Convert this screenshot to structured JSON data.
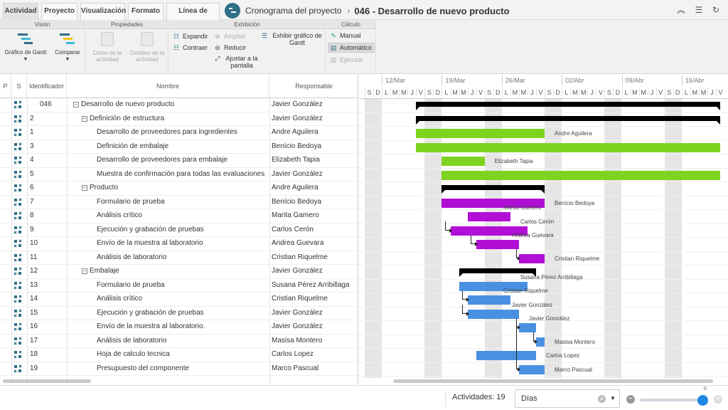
{
  "tabs": [
    {
      "label": "Actividad",
      "active": true
    },
    {
      "label": "Proyecto",
      "active": false
    },
    {
      "label": "Visualización",
      "active": false
    },
    {
      "label": "Formato",
      "active": false
    },
    {
      "label": "Línea de tiempo",
      "active": false
    }
  ],
  "breadcrumb": {
    "parent": "Cronograma del proyecto",
    "separator": "›",
    "title": "046 - Desarrollo de nuevo producto"
  },
  "top_icons": [
    "collapse-up-icon",
    "list-icon",
    "refresh-icon"
  ],
  "ribbon": {
    "vision": {
      "title": "Visión",
      "gantt_chart": "Gráfico de Gantt",
      "compare": "Comparar"
    },
    "properties": {
      "title": "Propiedades",
      "activity_data": "Datos de la actividad",
      "activity_details": "Detalles de la actividad"
    },
    "display": {
      "title": "Exhibición",
      "expand": "Expandir",
      "collapse": "Contraer",
      "zoom_in": "Ampliar",
      "zoom_out": "Reducir",
      "fit_screen": "Ajustar a la pantalla",
      "show_gantt": "Exhibir gráfico de Gantt"
    },
    "calc": {
      "title": "Cálculo",
      "manual": "Manual",
      "automatic": "Automático",
      "run": "Ejecutar"
    }
  },
  "grid": {
    "headers": {
      "p": "P",
      "s": "S",
      "id": "Identificador",
      "name": "Nombre",
      "responsible": "Responsable"
    },
    "rows": [
      {
        "id": "046",
        "name": "Desarrollo de nuevo producto",
        "resp": "Javier González",
        "level": 0,
        "toggle": "−"
      },
      {
        "id": "2",
        "name": "Definición de estructura",
        "resp": "Javier González",
        "level": 1,
        "toggle": "−"
      },
      {
        "id": "1",
        "name": "Desarrollo de proveedores para ingredientes",
        "resp": "Andre Aguilera",
        "level": 2,
        "toggle": ""
      },
      {
        "id": "3",
        "name": "Definición de embalaje",
        "resp": "Benício Bedoya",
        "level": 2,
        "toggle": ""
      },
      {
        "id": "4",
        "name": "Desarrollo de proveedores para embalaje",
        "resp": "Elizabeth Tapia",
        "level": 2,
        "toggle": ""
      },
      {
        "id": "5",
        "name": "Muestra de confirmación para todas las evaluaciones",
        "resp": "Javier González",
        "level": 2,
        "toggle": ""
      },
      {
        "id": "6",
        "name": "Producto",
        "resp": "Andre Aguilera",
        "level": 1,
        "toggle": "−"
      },
      {
        "id": "7",
        "name": "Formulario de prueba",
        "resp": "Benício Bedoya",
        "level": 2,
        "toggle": ""
      },
      {
        "id": "8",
        "name": "Análisis crítico",
        "resp": "Marita Gamero",
        "level": 2,
        "toggle": ""
      },
      {
        "id": "9",
        "name": "Ejecución y grabación de pruebas",
        "resp": "Carlos Cerón",
        "level": 2,
        "toggle": ""
      },
      {
        "id": "10",
        "name": "Envío de la muestra al laboratorio",
        "resp": "Andrea Guevara",
        "level": 2,
        "toggle": ""
      },
      {
        "id": "11",
        "name": "Análisis de laboratorio",
        "resp": "Cristian Riquelme",
        "level": 2,
        "toggle": ""
      },
      {
        "id": "12",
        "name": "Embalaje",
        "resp": "Javier González",
        "level": 1,
        "toggle": "−"
      },
      {
        "id": "13",
        "name": "Formulario de prueba",
        "resp": "Susana Pérez Arribillaga",
        "level": 2,
        "toggle": ""
      },
      {
        "id": "14",
        "name": "Análisis crítico",
        "resp": "Cristian Riquelme",
        "level": 2,
        "toggle": ""
      },
      {
        "id": "15",
        "name": "Ejecución y grabación de pruebas",
        "resp": "Javier González",
        "level": 2,
        "toggle": ""
      },
      {
        "id": "16",
        "name": "Envío de la muestra al laboratorio.",
        "resp": "Javier González",
        "level": 2,
        "toggle": ""
      },
      {
        "id": "17",
        "name": "Análisis de laboratorio",
        "resp": "Masisa Montero",
        "level": 2,
        "toggle": ""
      },
      {
        "id": "18",
        "name": "Hoja de calculo tecnica",
        "resp": "Carlos Lopez",
        "level": 2,
        "toggle": ""
      },
      {
        "id": "19",
        "name": "Presupuesto del componente",
        "resp": "Marco Pascual",
        "level": 2,
        "toggle": ""
      }
    ]
  },
  "gantt": {
    "weeks": [
      "12/Mar",
      "19/Mar",
      "26/Mar",
      "02/Abr",
      "09/Abr",
      "16/Abr"
    ],
    "day_letters": [
      "S",
      "D",
      "L",
      "M",
      "M",
      "J",
      "V",
      "S",
      "D",
      "L",
      "M",
      "M",
      "J",
      "V",
      "S",
      "D",
      "L",
      "M",
      "M",
      "J",
      "V",
      "S",
      "D",
      "L",
      "M",
      "M",
      "J",
      "V",
      "S",
      "D",
      "L",
      "M",
      "M",
      "J",
      "V",
      "S",
      "D",
      "L",
      "M",
      "M",
      "J",
      "V"
    ],
    "colors": {
      "green": "#7ed321",
      "purple": "#b10fd6",
      "blue": "#4a90e2",
      "summary": "#000000",
      "weekend": "#e5e5e5"
    },
    "tasks": [
      {
        "row": 0,
        "type": "summary",
        "start": 6,
        "end": 42,
        "label": ""
      },
      {
        "row": 1,
        "type": "summary",
        "start": 6,
        "end": 42,
        "label": ""
      },
      {
        "row": 2,
        "type": "bar",
        "color": "green",
        "start": 6,
        "end": 21,
        "label": "Andre Aguilera",
        "label_pos": "right"
      },
      {
        "row": 3,
        "type": "bar",
        "color": "green",
        "start": 6,
        "end": 42,
        "label": "",
        "label_pos": "right"
      },
      {
        "row": 4,
        "type": "bar",
        "color": "green",
        "start": 9,
        "end": 14,
        "label": "Elizabeth Tapia",
        "label_pos": "right"
      },
      {
        "row": 5,
        "type": "bar",
        "color": "green",
        "start": 9,
        "end": 42,
        "label": "",
        "label_pos": "right"
      },
      {
        "row": 6,
        "type": "summary",
        "start": 9,
        "end": 21,
        "label": ""
      },
      {
        "row": 7,
        "type": "bar",
        "color": "purple",
        "start": 9,
        "end": 21,
        "label": "Benício Bedoya",
        "label_pos": "right"
      },
      {
        "row": 8,
        "type": "bar",
        "color": "purple",
        "start": 12,
        "end": 17,
        "label": "Marita Gamero",
        "label_pos": "above"
      },
      {
        "row": 9,
        "type": "bar",
        "color": "purple",
        "start": 10,
        "end": 19,
        "label": "Carlos Cerón",
        "label_pos": "above",
        "dep_from": 8
      },
      {
        "row": 10,
        "type": "bar",
        "color": "purple",
        "start": 13,
        "end": 18,
        "label": "Andrea Guevara",
        "label_pos": "above",
        "dep_from": 9
      },
      {
        "row": 11,
        "type": "bar",
        "color": "purple",
        "start": 18,
        "end": 21,
        "label": "Cristian Riquelme",
        "label_pos": "right",
        "dep_from": 10
      },
      {
        "row": 12,
        "type": "summary",
        "start": 11,
        "end": 20,
        "label": ""
      },
      {
        "row": 13,
        "type": "bar",
        "color": "blue",
        "start": 11,
        "end": 19,
        "label": "Susana Pérez Arribillaga",
        "label_pos": "above"
      },
      {
        "row": 14,
        "type": "bar",
        "color": "blue",
        "start": 12,
        "end": 17,
        "label": "Cristian Riquelme",
        "label_pos": "above",
        "dep_from": 13
      },
      {
        "row": 15,
        "type": "bar",
        "color": "blue",
        "start": 12,
        "end": 18,
        "label": "Javier González",
        "label_pos": "above",
        "dep_from": 14
      },
      {
        "row": 16,
        "type": "bar",
        "color": "blue",
        "start": 18,
        "end": 20,
        "label": "Javier González",
        "label_pos": "above",
        "dep_from": 15
      },
      {
        "row": 17,
        "type": "bar",
        "color": "blue",
        "start": 20,
        "end": 21,
        "label": "Masisa Montero",
        "label_pos": "right",
        "dep_from": 16
      },
      {
        "row": 18,
        "type": "bar",
        "color": "blue",
        "start": 13,
        "end": 20,
        "label": "Carlos Lopez",
        "label_pos": "right"
      },
      {
        "row": 19,
        "type": "bar",
        "color": "blue",
        "start": 18,
        "end": 21,
        "label": "Marco Pascual",
        "label_pos": "right",
        "dep_from": 15
      }
    ]
  },
  "footer": {
    "activities": "Actividades: 19",
    "period": "Días",
    "zoom_value": "0",
    "zoom_level": 1.0
  }
}
